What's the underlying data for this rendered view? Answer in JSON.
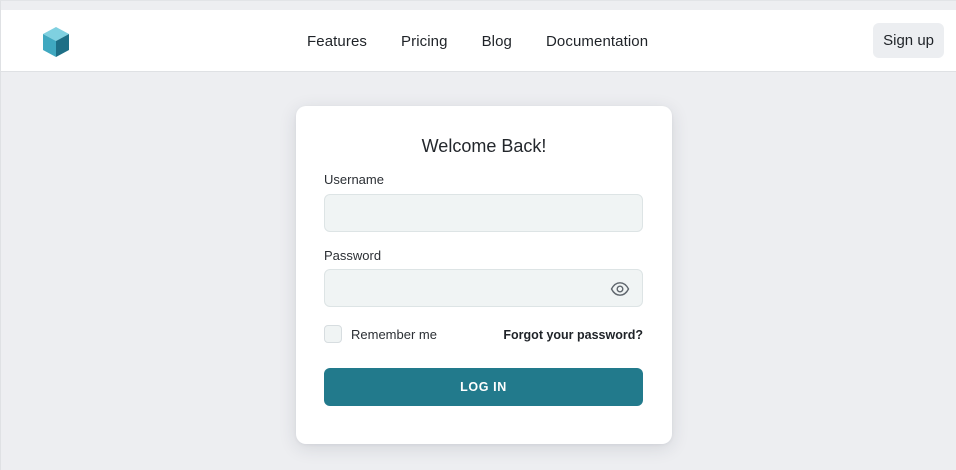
{
  "nav": {
    "logo_icon": "cube-logo-icon",
    "links": [
      "Features",
      "Pricing",
      "Blog",
      "Documentation"
    ],
    "signup_label": "Sign up"
  },
  "login": {
    "title": "Welcome Back!",
    "username_label": "Username",
    "username_value": "",
    "password_label": "Password",
    "password_value": "",
    "eye_icon": "eye-icon",
    "remember_label": "Remember me",
    "remember_checked": false,
    "forgot_label": "Forgot your password?",
    "submit_label": "LOG IN"
  },
  "colors": {
    "accent": "#227a8c",
    "page_background": "#edeef1",
    "input_background": "#f0f4f4",
    "logo_light": "#7fd0e0",
    "logo_mid": "#3fa8c0",
    "logo_dark": "#1e6f86"
  }
}
